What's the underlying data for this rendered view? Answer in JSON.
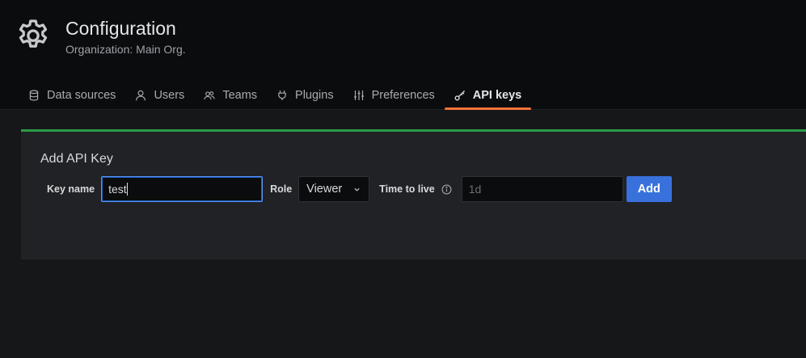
{
  "header": {
    "icon": "gear-icon",
    "title": "Configuration",
    "subtitle": "Organization: Main Org."
  },
  "tabs": [
    {
      "label": "Data sources",
      "icon": "database-icon",
      "active": false
    },
    {
      "label": "Users",
      "icon": "user-icon",
      "active": false
    },
    {
      "label": "Teams",
      "icon": "users-icon",
      "active": false
    },
    {
      "label": "Plugins",
      "icon": "plug-icon",
      "active": false
    },
    {
      "label": "Preferences",
      "icon": "sliders-icon",
      "active": false
    },
    {
      "label": "API keys",
      "icon": "key-icon",
      "active": true
    }
  ],
  "form": {
    "title": "Add API Key",
    "key_name_label": "Key name",
    "key_name_value": "test",
    "role_label": "Role",
    "role_value": "Viewer",
    "ttl_label": "Time to live",
    "ttl_value": "",
    "ttl_placeholder": "1d",
    "add_label": "Add"
  },
  "colors": {
    "accent_blue": "#3871dc",
    "active_tab_underline": "#f3733a",
    "panel_top_border": "#299c46",
    "focus_border": "#5794f2"
  }
}
